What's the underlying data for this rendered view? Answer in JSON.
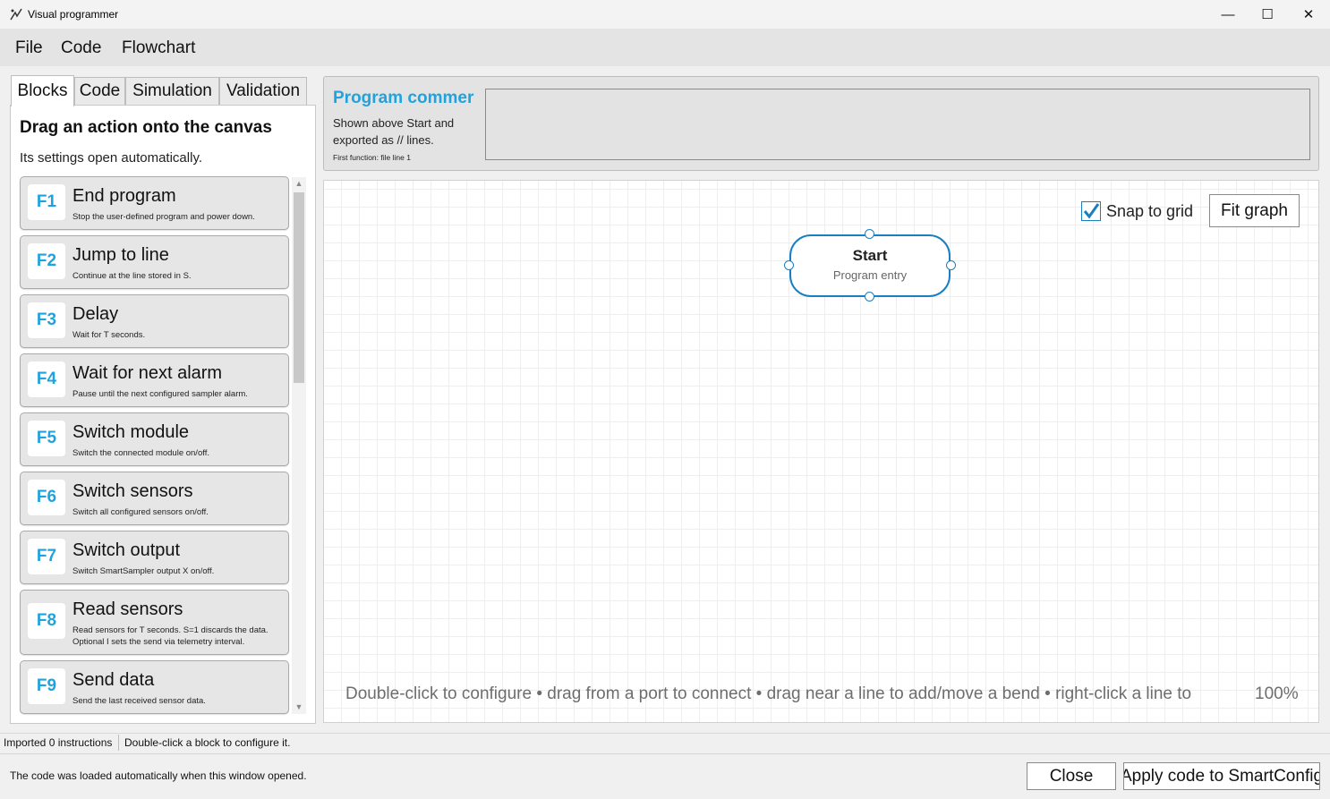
{
  "window": {
    "title": "Visual programmer",
    "minimize": "—",
    "maximize": "☐",
    "close": "✕"
  },
  "menu": [
    "File",
    "Code",
    "Flowchart"
  ],
  "tabs": [
    "Blocks",
    "Code",
    "Simulation",
    "Validation"
  ],
  "blocks_panel": {
    "heading": "Drag an action onto the canvas",
    "subheading": "Its settings open automatically.",
    "items": [
      {
        "key": "F1",
        "title": "End program",
        "desc": "Stop the user-defined program and power down."
      },
      {
        "key": "F2",
        "title": "Jump to line",
        "desc": "Continue at the line stored in S."
      },
      {
        "key": "F3",
        "title": "Delay",
        "desc": "Wait for T seconds."
      },
      {
        "key": "F4",
        "title": "Wait for next alarm",
        "desc": "Pause until the next configured sampler alarm."
      },
      {
        "key": "F5",
        "title": "Switch module",
        "desc": "Switch the connected module on/off."
      },
      {
        "key": "F6",
        "title": "Switch sensors",
        "desc": "Switch all configured sensors on/off."
      },
      {
        "key": "F7",
        "title": "Switch output",
        "desc": "Switch SmartSampler output X on/off."
      },
      {
        "key": "F8",
        "title": "Read sensors",
        "desc": "Read sensors for T seconds. S=1 discards the data. Optional I sets the send via telemetry interval."
      },
      {
        "key": "F9",
        "title": "Send data",
        "desc": "Send the last received sensor data."
      }
    ]
  },
  "comment": {
    "title": "Program commer",
    "help": "Shown above Start and exported as // lines.",
    "note": "First function: file line 1",
    "value": ""
  },
  "canvas": {
    "snap_label": "Snap to grid",
    "snap_checked": true,
    "fit_label": "Fit graph",
    "start_title": "Start",
    "start_subtitle": "Program entry",
    "help": "Double-click to configure • drag from a port to connect • drag near a line to add/move a bend • right-click a line to",
    "zoom": "100%"
  },
  "status": {
    "left": "Imported 0 instructions",
    "right": "Double-click a block to configure it."
  },
  "bottom": {
    "message": "The code was loaded automatically when this window opened.",
    "close_label": "Close",
    "apply_label": "Apply code to SmartConfig"
  },
  "colors": {
    "accent": "#1fa3de",
    "node_border": "#1a7fc1"
  }
}
